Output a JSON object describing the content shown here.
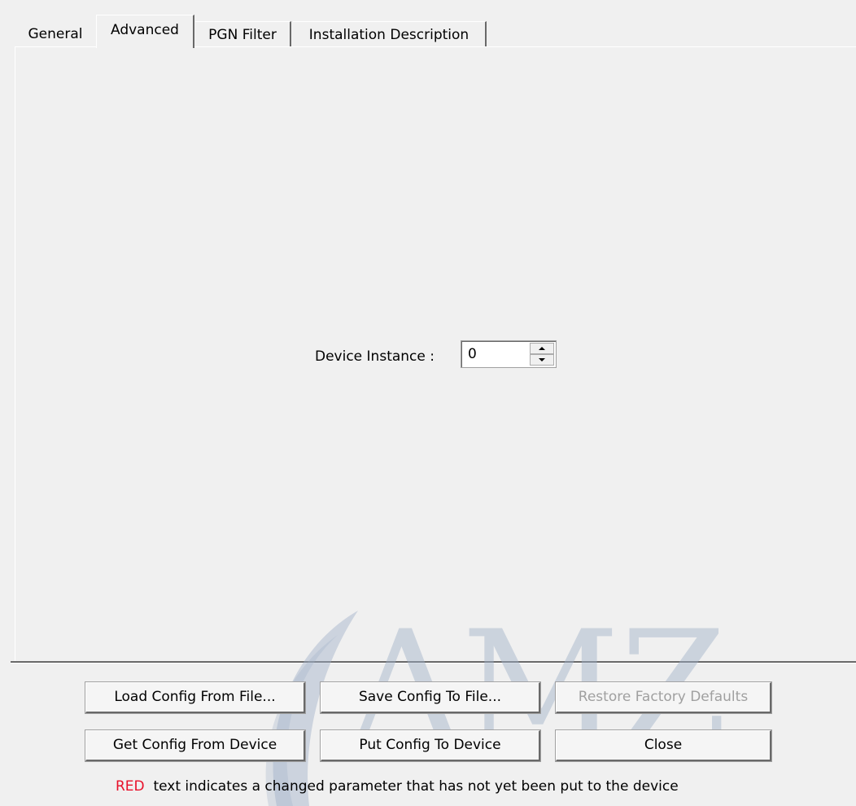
{
  "tabs": [
    {
      "label": "General",
      "active": false
    },
    {
      "label": "Advanced",
      "active": true
    },
    {
      "label": "PGN Filter",
      "active": false
    },
    {
      "label": "Installation Description",
      "active": false
    }
  ],
  "advanced": {
    "device_instance_label": "Device Instance :",
    "device_instance_value": "0"
  },
  "buttons": {
    "load": "Load Config From File...",
    "save": "Save Config To File...",
    "restore": "Restore Factory Defaults",
    "get": "Get Config From Device",
    "put": "Put Config To Device",
    "close": "Close"
  },
  "footnote": {
    "red_word": "RED",
    "text": "text indicates a changed parameter that has not yet been put to the device"
  },
  "watermark": {
    "text": "AMZ"
  },
  "colors": {
    "background": "#f0f0f0",
    "highlight_red": "#e8102a",
    "watermark": "#9fb0c8"
  },
  "icons": [
    "spin-up-icon",
    "spin-down-icon"
  ]
}
